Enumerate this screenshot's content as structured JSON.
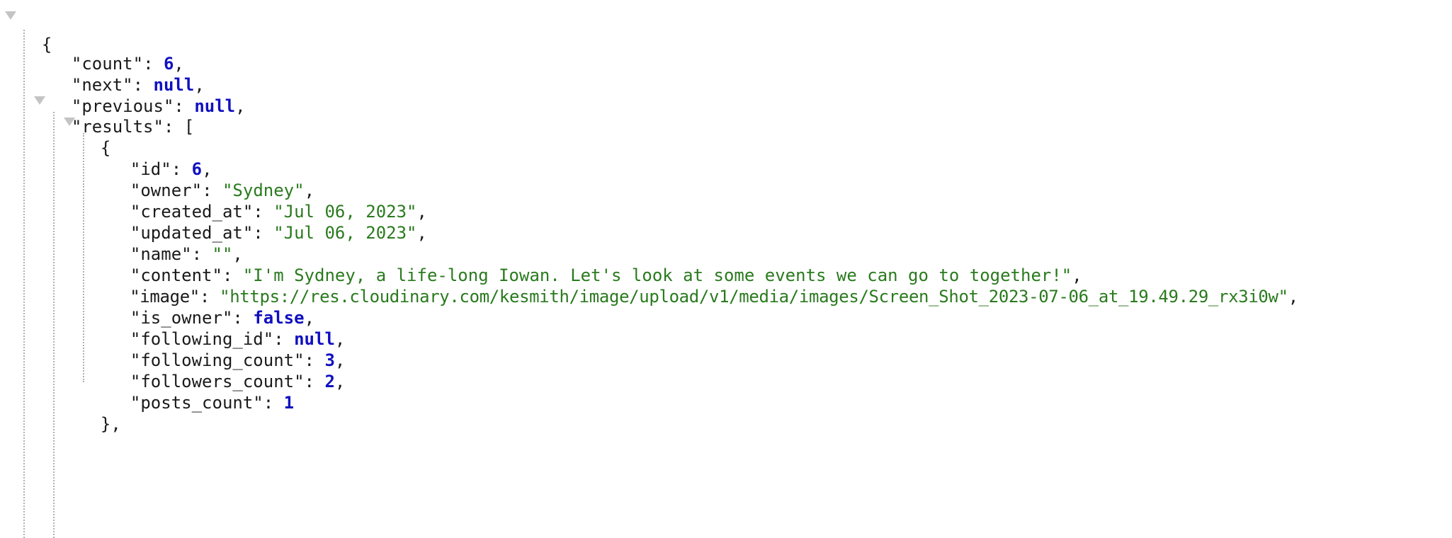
{
  "viewer": {
    "open_brace": "{",
    "root": [
      {
        "key": "\"count\"",
        "value": "6",
        "type": "number",
        "sep": ","
      },
      {
        "key": "\"next\"",
        "value": "null",
        "type": "null",
        "sep": ","
      },
      {
        "key": "\"previous\"",
        "value": "null",
        "type": "null",
        "sep": ","
      }
    ],
    "results_key": "\"results\"",
    "results_open": "[",
    "item_open": "{",
    "item": [
      {
        "key": "\"id\"",
        "value": "6",
        "type": "number",
        "sep": ","
      },
      {
        "key": "\"owner\"",
        "value": "\"Sydney\"",
        "type": "string",
        "sep": ","
      },
      {
        "key": "\"created_at\"",
        "value": "\"Jul 06, 2023\"",
        "type": "string",
        "sep": ","
      },
      {
        "key": "\"updated_at\"",
        "value": "\"Jul 06, 2023\"",
        "type": "string",
        "sep": ","
      },
      {
        "key": "\"name\"",
        "value": "\"\"",
        "type": "string",
        "sep": ","
      },
      {
        "key": "\"content\"",
        "value": "\"I'm Sydney, a life-long Iowan. Let's look at some events we can go to together!\"",
        "type": "string",
        "sep": ","
      },
      {
        "key": "\"image\"",
        "value": "\"https://res.cloudinary.com/kesmith/image/upload/v1/media/images/Screen_Shot_2023-07-06_at_19.49.29_rx3i0w\"",
        "type": "string",
        "sep": ","
      },
      {
        "key": "\"is_owner\"",
        "value": "false",
        "type": "boolean",
        "sep": ","
      },
      {
        "key": "\"following_id\"",
        "value": "null",
        "type": "null",
        "sep": ","
      },
      {
        "key": "\"following_count\"",
        "value": "3",
        "type": "number",
        "sep": ","
      },
      {
        "key": "\"followers_count\"",
        "value": "2",
        "type": "number",
        "sep": ","
      },
      {
        "key": "\"posts_count\"",
        "value": "1",
        "type": "number",
        "sep": ""
      }
    ],
    "item_close": "},",
    "colon": ": ",
    "colors": {
      "key": "#1a1a1a",
      "string": "#2a7a1e",
      "number": "#1010c0",
      "keyword": "#1010c0",
      "toggle": "#c4c4c4",
      "guide": "#b0b0b0"
    },
    "icons": {
      "toggle": "collapse-triangle-icon"
    }
  }
}
